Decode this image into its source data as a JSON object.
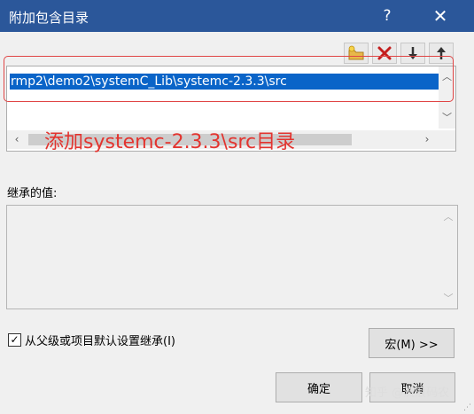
{
  "dialog": {
    "title": "附加包含目录",
    "help_label": "?",
    "close_label": "✕"
  },
  "toolbar": {
    "buttons": [
      {
        "icon": "new-folder-icon"
      },
      {
        "icon": "delete-icon"
      },
      {
        "icon": "move-down-icon"
      },
      {
        "icon": "move-up-icon"
      }
    ]
  },
  "list": {
    "items": [
      "rmp2\\demo2\\systemC_Lib\\systemc-2.3.3\\src"
    ]
  },
  "annotation": {
    "text": "添加systemc-2.3.3\\src目录",
    "color": "#e3342f"
  },
  "inherited": {
    "label": "继承的值:"
  },
  "inherit_checkbox": {
    "checked": true,
    "label": "从父级或项目默认设置继承(I)"
  },
  "buttons": {
    "macro": "宏(M) >>",
    "ok": "确定",
    "cancel": "取消"
  },
  "watermark": "知乎 @流浪码农",
  "colors": {
    "titlebar": "#2b579a",
    "selection": "#0a64c8"
  }
}
